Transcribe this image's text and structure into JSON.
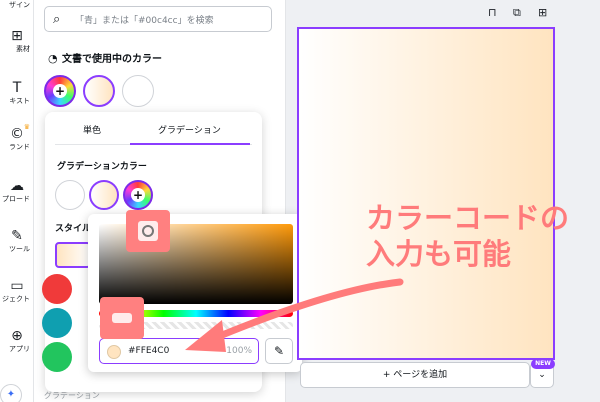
{
  "rail": {
    "items": [
      {
        "label": "ザイン",
        "icon": "layout-icon"
      },
      {
        "label": "素材",
        "icon": "elements-icon"
      },
      {
        "label": "キスト",
        "icon": "text-icon"
      },
      {
        "label": "ランド",
        "icon": "brand-icon"
      },
      {
        "label": "プロード",
        "icon": "upload-icon"
      },
      {
        "label": "ツール",
        "icon": "draw-icon"
      },
      {
        "label": "ジェクト",
        "icon": "folder-icon"
      },
      {
        "label": "アプリ",
        "icon": "apps-icon"
      }
    ],
    "glyphs": {
      "elements": "⊞",
      "text": "T",
      "brand": "©",
      "upload": "☁",
      "draw": "✎",
      "folder": "▭",
      "apps": "⊕",
      "crown": "♛"
    }
  },
  "panel": {
    "search_placeholder": "「青」または「#00c4cc」を検索",
    "document_colors_title": "文書で使用中のカラー",
    "bottom_label": "グラデーション"
  },
  "popover": {
    "tab_solid": "単色",
    "tab_gradient": "グラデーション",
    "gradient_colors_title": "グラデーションカラー",
    "style_title": "スタイル"
  },
  "picker": {
    "hex_value": "#FFE4C0",
    "opacity": "100%",
    "eyedropper_glyph": "✎"
  },
  "canvas": {
    "add_page_label": "+ ページを追加",
    "new_badge": "NEW",
    "chevron": "⌄"
  },
  "annotation": {
    "line1": "カラーコードの",
    "line2": "入力も可能"
  },
  "colors": {
    "accent": "#8b3dff",
    "peach": "#ffe4c0",
    "callout": "#ff8080",
    "palette": [
      "#f03a3a",
      "#0f9fb0",
      "#22c55e"
    ]
  }
}
